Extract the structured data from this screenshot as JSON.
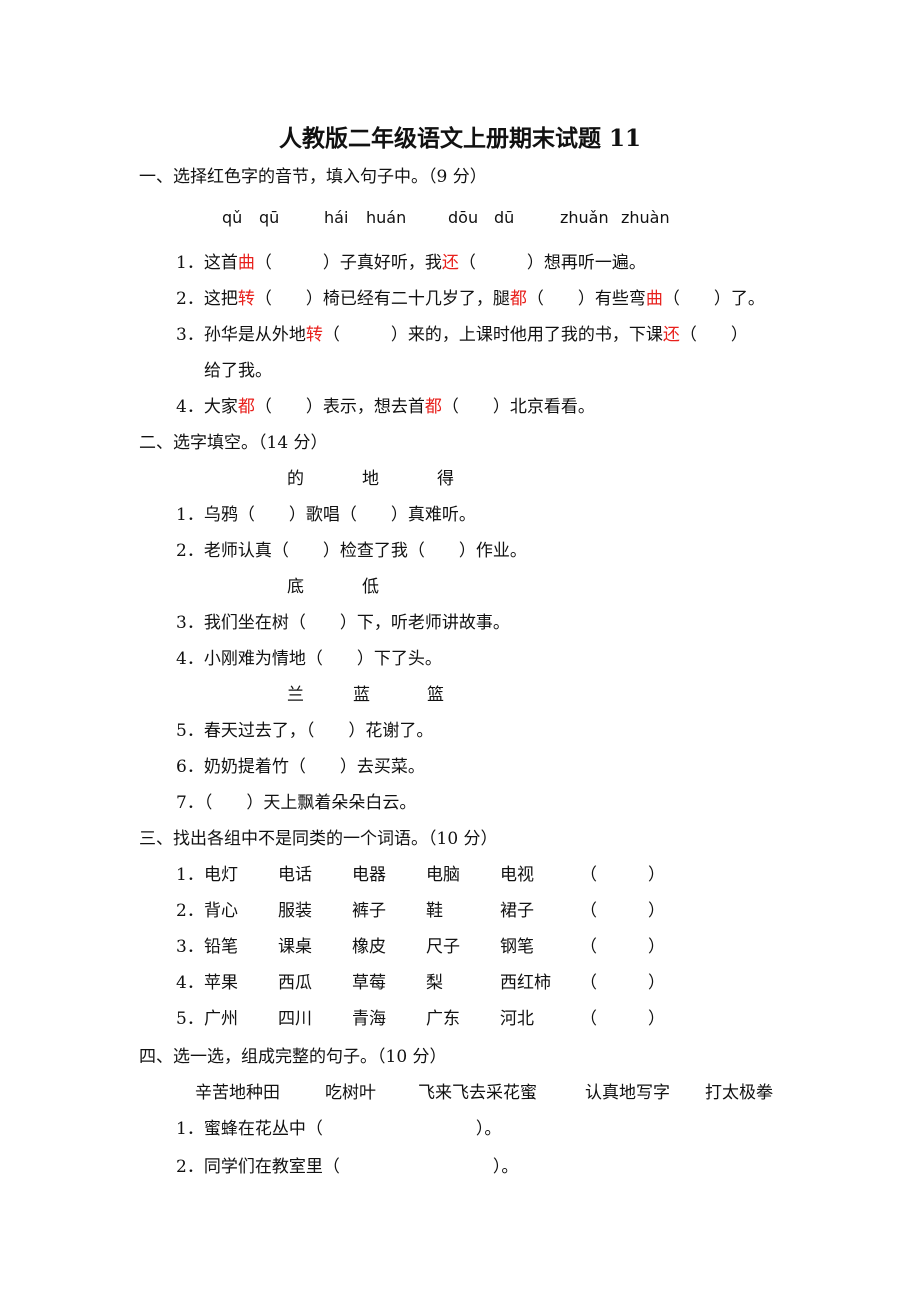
{
  "title": "人教版二年级语文上册期末试题 11",
  "section1": {
    "heading": "一、选择红色字的音节，填入句子中。（9 分）",
    "pinyin": [
      "qǔ",
      "qū",
      "hái",
      "huán",
      "dōu",
      "dū",
      "zhuǎn",
      "zhuàn"
    ],
    "items": [
      {
        "parts": [
          {
            "t": "1．这首"
          },
          {
            "t": "曲",
            "red": true
          },
          {
            "t": "（　　　）子真好听，我"
          },
          {
            "t": "还",
            "red": true
          },
          {
            "t": "（　　　）想再听一遍。"
          }
        ]
      },
      {
        "parts": [
          {
            "t": "2．这把"
          },
          {
            "t": "转",
            "red": true
          },
          {
            "t": "（　　）椅已经有二十几岁了，腿"
          },
          {
            "t": "都",
            "red": true
          },
          {
            "t": "（　　）有些弯"
          },
          {
            "t": "曲",
            "red": true
          },
          {
            "t": "（　　）了。"
          }
        ]
      },
      {
        "parts": [
          {
            "t": "3．孙华是从外地"
          },
          {
            "t": "转",
            "red": true
          },
          {
            "t": "（　　　）来的，上课时他用了我的书，下课"
          },
          {
            "t": "还",
            "red": true
          },
          {
            "t": "（　　）"
          }
        ]
      },
      {
        "parts": [
          {
            "t": "给了我。"
          }
        ]
      },
      {
        "parts": [
          {
            "t": "4．大家"
          },
          {
            "t": "都",
            "red": true
          },
          {
            "t": "（　　）表示，想去首"
          },
          {
            "t": "都",
            "red": true
          },
          {
            "t": "（　　）北京看看。"
          }
        ]
      }
    ]
  },
  "section2": {
    "heading": "二、选字填空。（14 分）",
    "group1": [
      "的",
      "地",
      "得"
    ],
    "items1": [
      "1．乌鸦（　　）歌唱（　　）真难听。",
      "2．老师认真（　　）检查了我（　　）作业。"
    ],
    "group2": [
      "底",
      "低"
    ],
    "items2": [
      "3．我们坐在树（　　）下，听老师讲故事。",
      "4．小刚难为情地（　　）下了头。"
    ],
    "group3": [
      "兰",
      "蓝",
      "篮"
    ],
    "items3": [
      "5．春天过去了，（　　）花谢了。",
      "6．奶奶提着竹（　　）去买菜。",
      "7．（　　）天上飘着朵朵白云。"
    ]
  },
  "section3": {
    "heading": "三、找出各组中不是同类的一个词语。（10 分）",
    "rows": [
      {
        "num": "1．",
        "words": [
          "电灯",
          "电话",
          "电器",
          "电脑",
          "电视"
        ],
        "blank": "（　　　）"
      },
      {
        "num": "2．",
        "words": [
          "背心",
          "服装",
          "裤子",
          "鞋",
          "裙子"
        ],
        "blank": "（　　　）"
      },
      {
        "num": "3．",
        "words": [
          "铅笔",
          "课桌",
          "橡皮",
          "尺子",
          "钢笔"
        ],
        "blank": "（　　　）"
      },
      {
        "num": "4．",
        "words": [
          "苹果",
          "西瓜",
          "草莓",
          "梨",
          "西红柿"
        ],
        "blank": "（　　　）"
      },
      {
        "num": "5．",
        "words": [
          "广州",
          "四川",
          "青海",
          "广东",
          "河北"
        ],
        "blank": "（　　　）"
      }
    ]
  },
  "section4": {
    "heading": "四、选一选，组成完整的句子。（10 分）",
    "options": [
      "辛苦地种田",
      "吃树叶",
      "飞来飞去采花蜜",
      "认真地写字",
      "打太极拳"
    ],
    "items": [
      "1．蜜蜂在花丛中（　　　　　　　　　）。",
      "2．同学们在教室里（　　　　　　　　　）。"
    ]
  }
}
